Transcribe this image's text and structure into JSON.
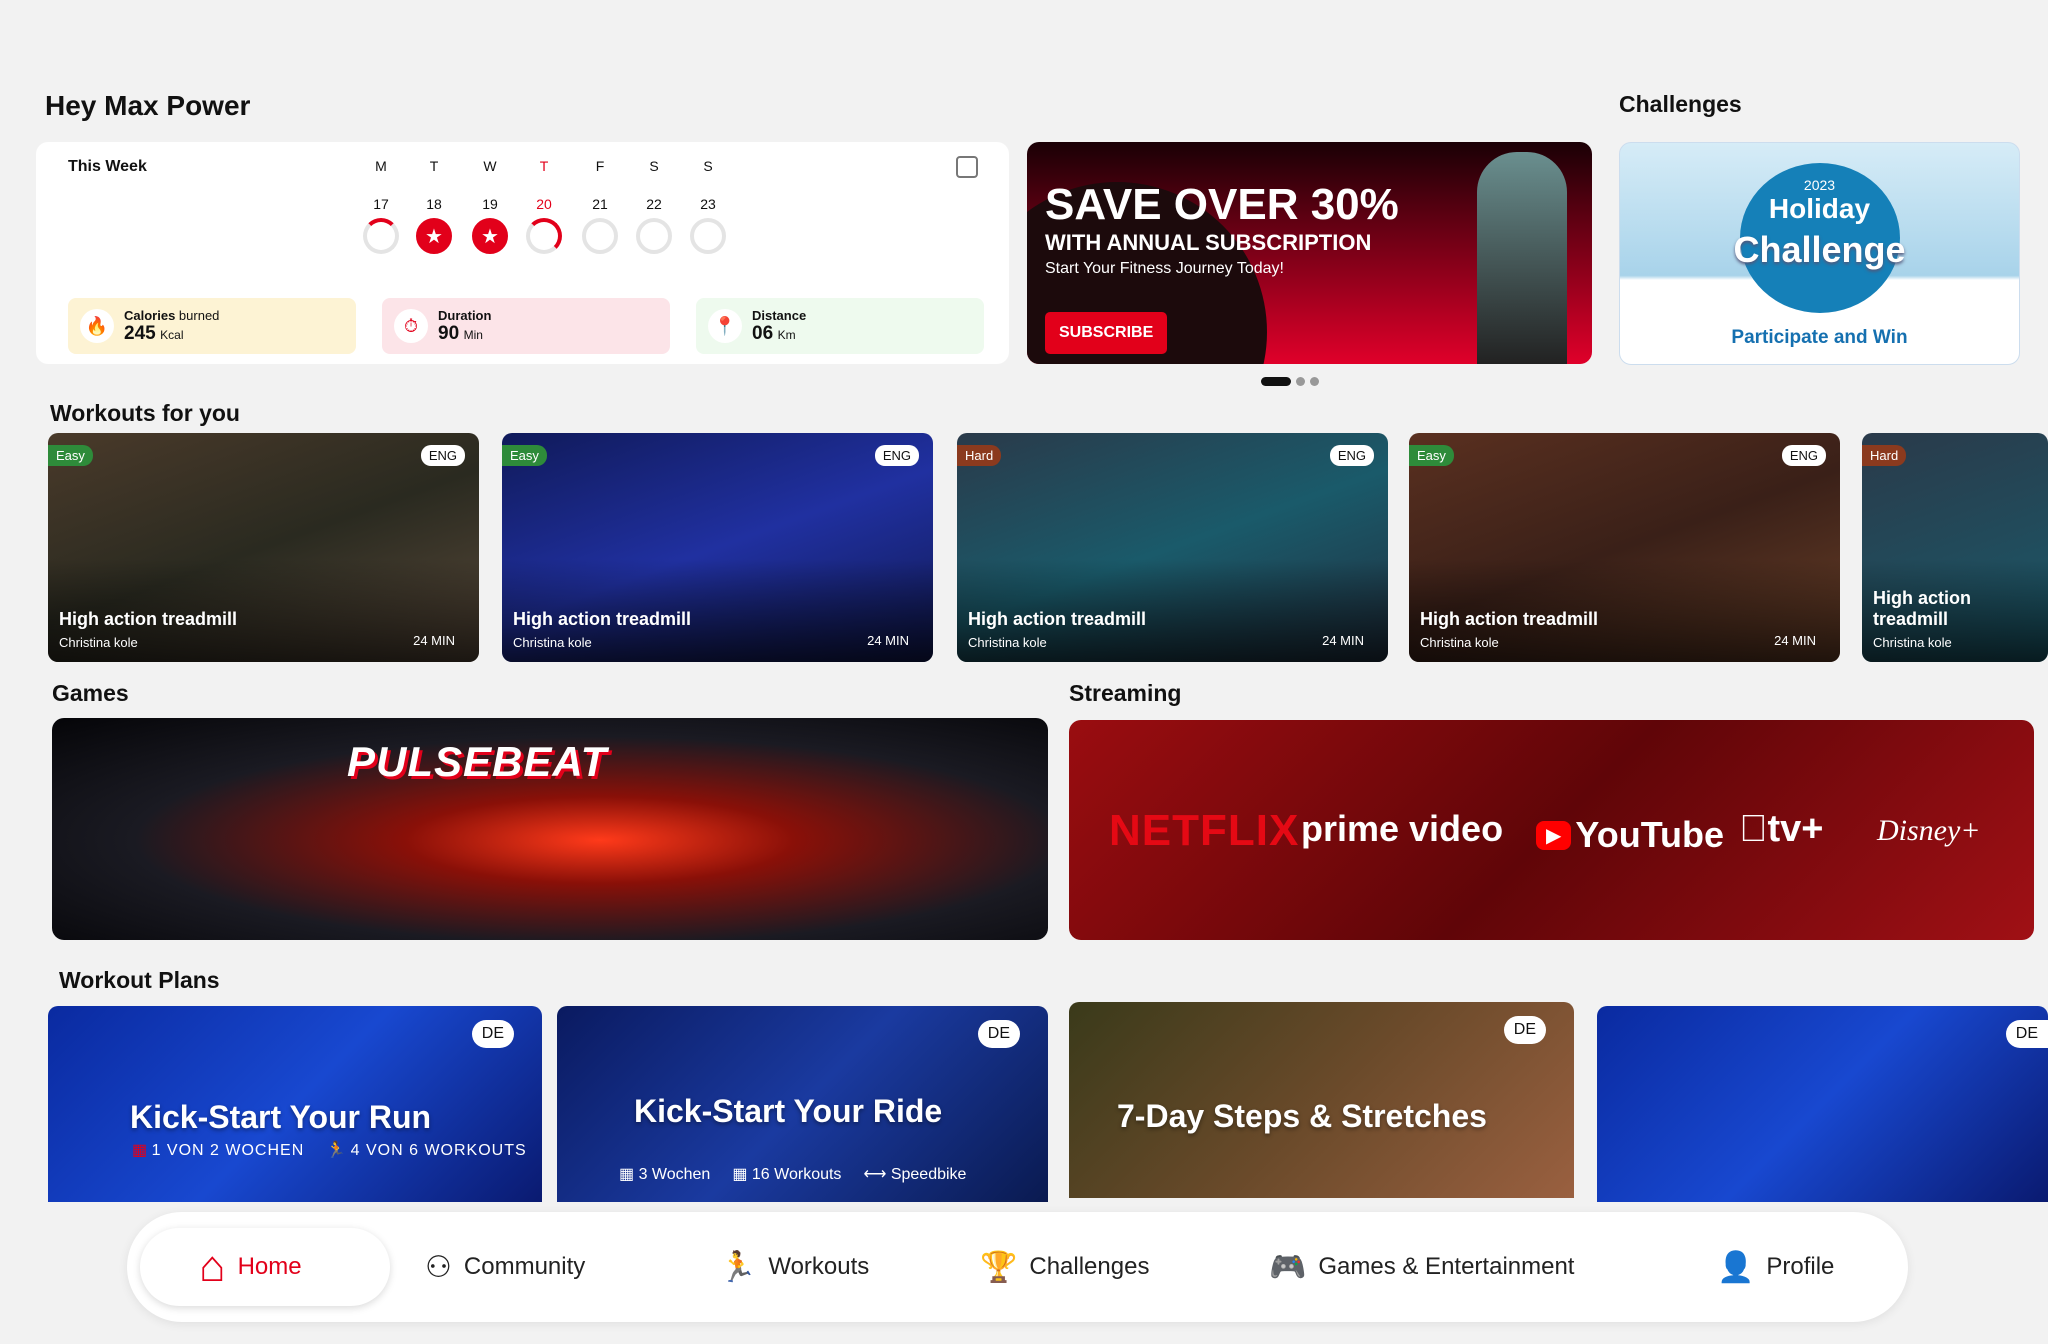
{
  "greeting": "Hey Max Power",
  "week": {
    "title": "This Week",
    "days": [
      {
        "letter": "M",
        "date": "17",
        "status": "partial",
        "progress": 0.25
      },
      {
        "letter": "T",
        "date": "18",
        "status": "done",
        "progress": 1
      },
      {
        "letter": "W",
        "date": "19",
        "status": "done",
        "progress": 1
      },
      {
        "letter": "T",
        "date": "20",
        "status": "today",
        "progress": 0.5
      },
      {
        "letter": "F",
        "date": "21",
        "status": "none",
        "progress": 0
      },
      {
        "letter": "S",
        "date": "22",
        "status": "none",
        "progress": 0
      },
      {
        "letter": "S",
        "date": "23",
        "status": "none",
        "progress": 0
      }
    ],
    "stats": [
      {
        "label": "Calories",
        "label2": " burned",
        "value": "245",
        "unit": "Kcal",
        "icon": "flame-icon",
        "color": "#fdf3d4"
      },
      {
        "label": "Duration",
        "label2": "",
        "value": "90",
        "unit": "Min",
        "icon": "stopwatch-icon",
        "color": "#fce4e8"
      },
      {
        "label": "Distance",
        "label2": "",
        "value": "06",
        "unit": "Km",
        "icon": "route-icon",
        "color": "#eefaee"
      }
    ]
  },
  "promo": {
    "headline": "SAVE OVER 30%",
    "sub": "WITH ANNUAL SUBSCRIPTION",
    "tagline": "Start Your Fitness Journey Today!",
    "button": "SUBSCRIBE",
    "slides": 3,
    "active_slide": 1
  },
  "challenges": {
    "title": "Challenges",
    "year": "2023",
    "line1": "Holiday",
    "line2": "Challenge",
    "cta": "Participate and Win"
  },
  "workouts": {
    "title": "Workouts for you",
    "items": [
      {
        "level": "Easy",
        "lang": "ENG",
        "title": "High action treadmill",
        "trainer": "Christina kole",
        "duration": "24 MIN"
      },
      {
        "level": "Easy",
        "lang": "ENG",
        "title": "High action treadmill",
        "trainer": "Christina kole",
        "duration": "24 MIN"
      },
      {
        "level": "Hard",
        "lang": "ENG",
        "title": "High action treadmill",
        "trainer": "Christina kole",
        "duration": "24 MIN"
      },
      {
        "level": "Easy",
        "lang": "ENG",
        "title": "High action treadmill",
        "trainer": "Christina kole",
        "duration": "24 MIN"
      },
      {
        "level": "Hard",
        "lang": "",
        "title": "High action treadmill",
        "trainer": "Christina kole",
        "duration": ""
      }
    ]
  },
  "games": {
    "title": "Games",
    "game": "PULSEBEAT"
  },
  "streaming": {
    "title": "Streaming",
    "services": [
      "NETFLIX",
      "prime video",
      "YouTube",
      "tv+",
      "Disney+"
    ]
  },
  "plans": {
    "title": "Workout Plans",
    "items": [
      {
        "lang": "DE",
        "title": "Kick-Start Your Run",
        "meta": [
          "1 VON 2 WOCHEN",
          "4 VON 6 WORKOUTS"
        ]
      },
      {
        "lang": "DE",
        "title": "Kick-Start Your Ride",
        "meta": [
          "3 Wochen",
          "16 Workouts",
          "Speedbike"
        ]
      },
      {
        "lang": "DE",
        "title": "7-Day Steps & Stretches",
        "meta": []
      },
      {
        "lang": "DE",
        "title": "",
        "meta": []
      }
    ]
  },
  "nav": {
    "items": [
      "Home",
      "Community",
      "Workouts",
      "Challenges",
      "Games & Entertainment",
      "Profile"
    ],
    "active": "Home"
  },
  "colors": {
    "accent": "#e2001a",
    "easy": "#2e8b3a",
    "hard": "#8b3a1e"
  }
}
